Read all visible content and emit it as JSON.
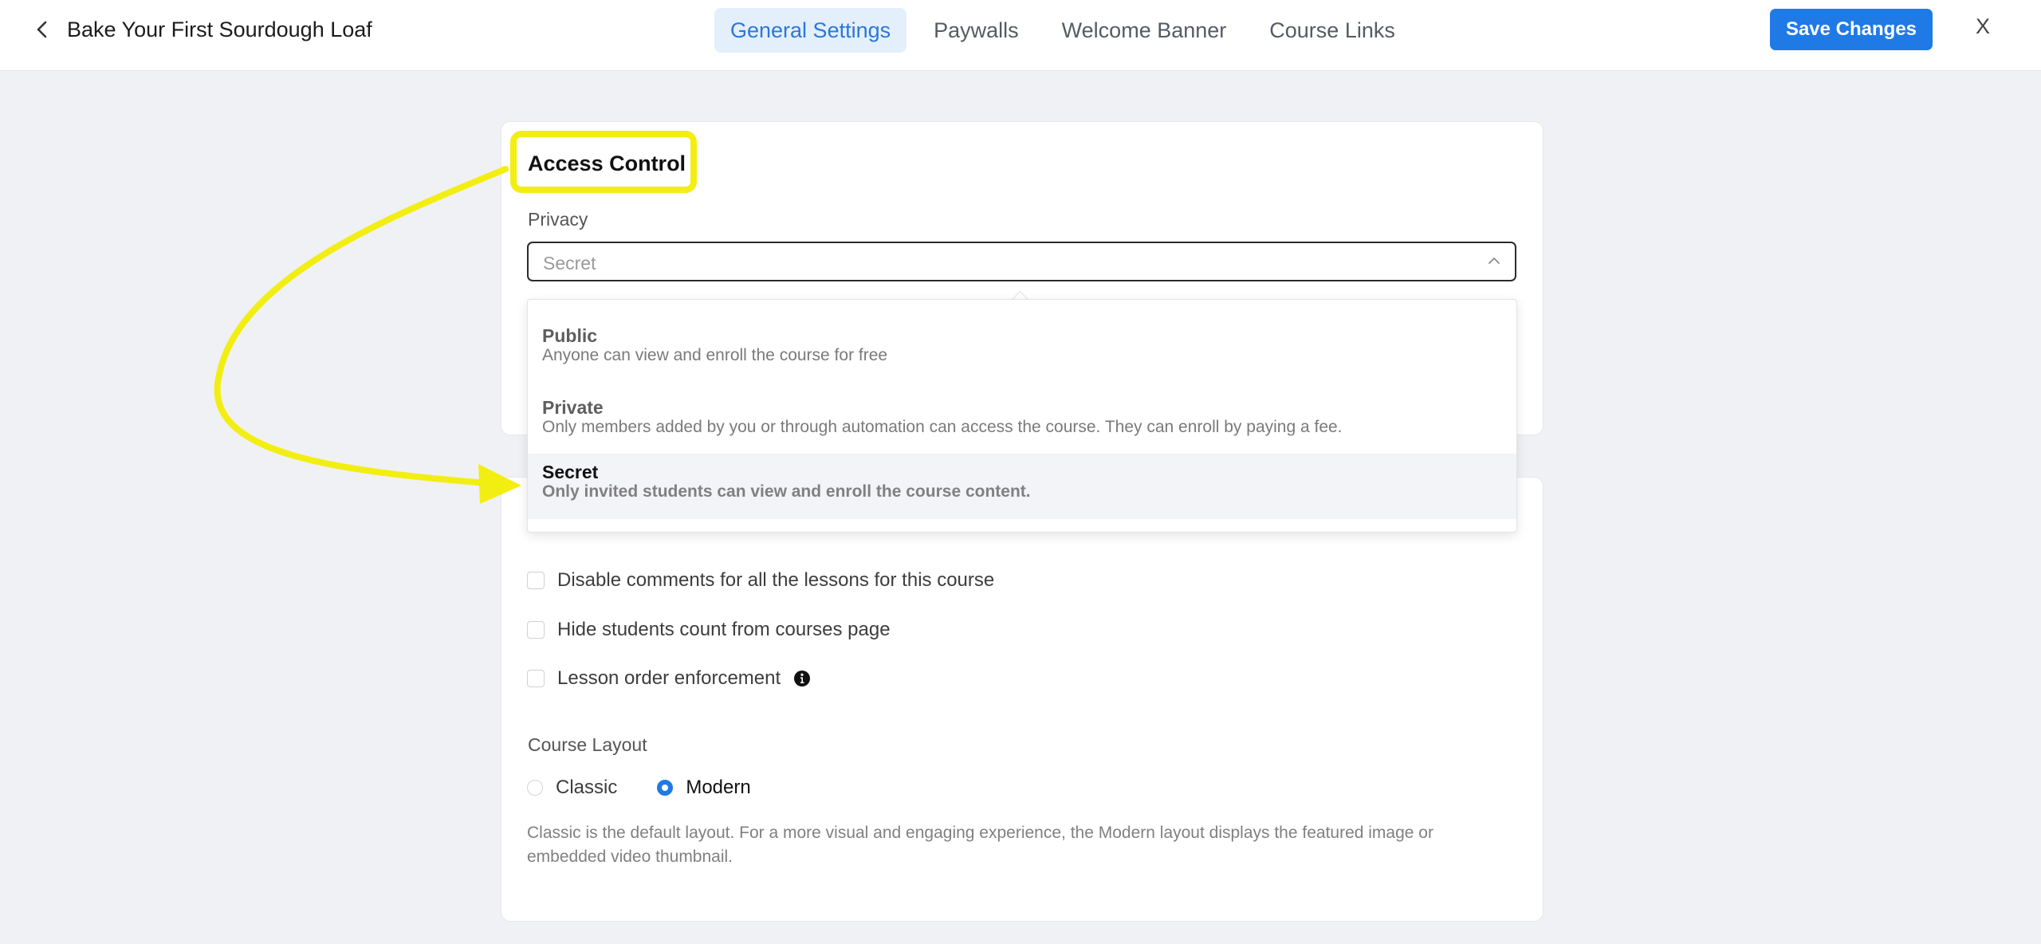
{
  "header": {
    "back_icon": "chevron-left-icon",
    "course_title": "Bake Your First Sourdough Loaf",
    "tabs": [
      {
        "label": "General Settings",
        "active": true
      },
      {
        "label": "Paywalls",
        "active": false
      },
      {
        "label": "Welcome Banner",
        "active": false
      },
      {
        "label": "Course Links",
        "active": false
      }
    ],
    "save_label": "Save Changes",
    "close_label": "X"
  },
  "access_control": {
    "title": "Access Control",
    "privacy_label": "Privacy",
    "privacy_value": "Secret",
    "options": [
      {
        "title": "Public",
        "desc": "Anyone can view and enroll the course for free"
      },
      {
        "title": "Private",
        "desc": "Only members added by you or through automation can access the course. They can enroll by paying a fee."
      },
      {
        "title": "Secret",
        "desc": "Only invited students can view and enroll the course content."
      }
    ]
  },
  "settings": {
    "checkboxes": [
      {
        "label": "Disable comments for all the lessons for this course",
        "checked": false
      },
      {
        "label": "Hide students count from courses page",
        "checked": false
      },
      {
        "label": "Lesson order enforcement",
        "checked": false
      }
    ],
    "course_layout_label": "Course Layout",
    "layout_options": [
      {
        "label": "Classic",
        "selected": false
      },
      {
        "label": "Modern",
        "selected": true
      }
    ],
    "layout_help": "Classic is the default layout. For a more visual and engaging experience, the Modern layout displays the featured image or embedded video thumbnail."
  },
  "colors": {
    "accent": "#1f7ae6",
    "annotation": "#f2ee12",
    "active_tab_bg": "#e4effc"
  }
}
